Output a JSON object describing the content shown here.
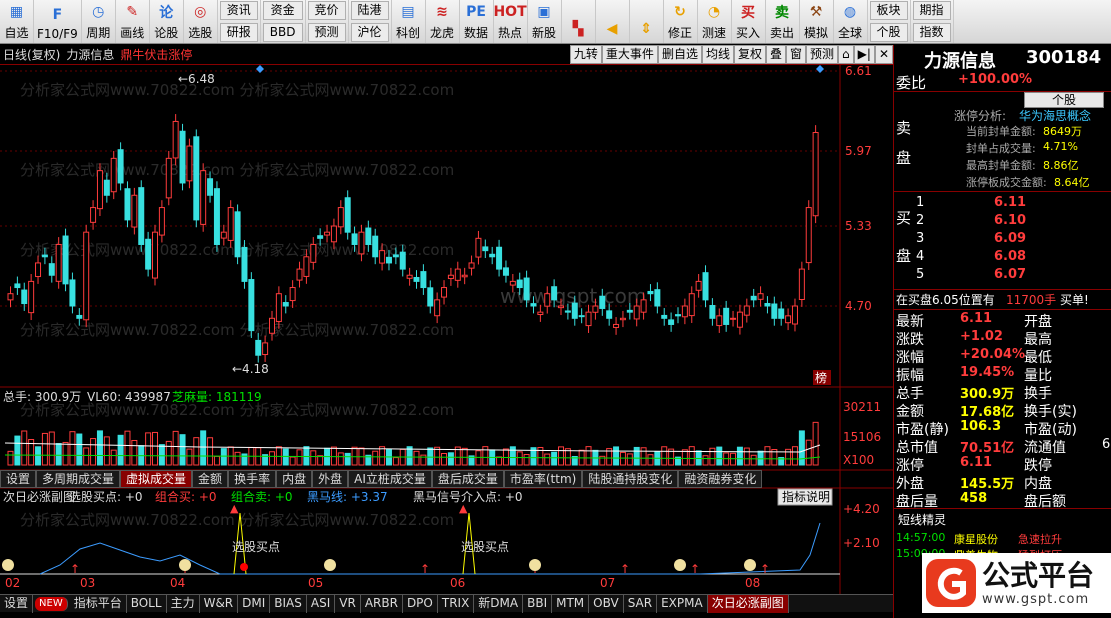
{
  "toolbar": {
    "items": [
      {
        "label": "自选",
        "icon": "grid-icon",
        "color": "#2a6fd6"
      },
      {
        "label": "F10/F9",
        "icon": "f10-icon",
        "color": "#2a6fd6"
      },
      {
        "label": "周期",
        "icon": "clock-icon",
        "color": "#2a6fd6"
      },
      {
        "label": "画线",
        "icon": "pencil-icon",
        "color": "#cc2222"
      },
      {
        "label": "论股",
        "icon": "talk-icon",
        "color": "#2a6fd6"
      },
      {
        "label": "选股",
        "icon": "radar-icon",
        "color": "#cc2222"
      }
    ],
    "pairs": [
      [
        "资讯",
        "研报"
      ],
      [
        "资金",
        "BBD"
      ],
      [
        "竞价",
        "预测"
      ],
      [
        "陆港",
        "沪伦"
      ]
    ],
    "items2": [
      {
        "label": "科创",
        "icon": "chart-icon",
        "color": "#2a6fd6"
      },
      {
        "label": "龙虎",
        "icon": "dragon-icon",
        "color": "#cc2222"
      },
      {
        "label": "数据",
        "icon": "pe-icon",
        "color": "#2a6fd6"
      },
      {
        "label": "热点",
        "icon": "hot-icon",
        "color": "#cc2222"
      },
      {
        "label": "新股",
        "icon": "ipo-icon",
        "color": "#2a6fd6"
      }
    ],
    "items3": [
      {
        "label": "",
        "icon": "multi-window-icon",
        "color": "#cc2222"
      },
      {
        "label": "",
        "icon": "back-arrow-icon",
        "color": "#e8a000"
      },
      {
        "label": "",
        "icon": "updown-arrow-icon",
        "color": "#e8a000"
      },
      {
        "label": "修正",
        "icon": "refresh-icon",
        "color": "#e8a000"
      },
      {
        "label": "测速",
        "icon": "stopwatch-icon",
        "color": "#e8a000"
      },
      {
        "label": "买入",
        "icon": "buy-icon",
        "color": "#cc2222"
      },
      {
        "label": "卖出",
        "icon": "sell-icon",
        "color": "#008800"
      },
      {
        "label": "模拟",
        "icon": "gavel-icon",
        "color": "#8b4513"
      },
      {
        "label": "全球",
        "icon": "globe-icon",
        "color": "#2a6fd6"
      }
    ],
    "pairs2": [
      [
        "板块",
        "个股"
      ],
      [
        "期指",
        "指数"
      ]
    ]
  },
  "title": {
    "label": "日线(复权)",
    "stock": "力源信息",
    "signal": "鼎牛伏击涨停",
    "buttons": [
      "九转",
      "重大事件",
      "删自选",
      "均线",
      "复权",
      "叠",
      "窗",
      "预测",
      "⌂",
      "▶|",
      "✕"
    ]
  },
  "chart_data": {
    "type": "candlestick",
    "price_ticks": [
      "6.61",
      "5.97",
      "5.33",
      "4.70"
    ],
    "high_label": "6.48",
    "low_label": "4.18",
    "volume_header": {
      "total": "总手: 300.9万",
      "vl60": "VL60: 439987",
      "zhima": "芝麻量: 181119"
    },
    "volume_ticks": [
      "30211",
      "15106",
      "X100"
    ],
    "indicator_header": {
      "name": "次日必涨副图",
      "a": "选股买点: +0",
      "b": "组合买: +0",
      "c": "组合卖: +0",
      "d": "黑马线: +3.37",
      "e": "黑马信号介入点: +0"
    },
    "indicator_button": "指标说明",
    "indicator_ticks": [
      "4.20",
      "2.10"
    ],
    "buy_labels": [
      "选股买点",
      "选股买点"
    ],
    "months": [
      "02",
      "03",
      "04",
      "05",
      "06",
      "07",
      "08"
    ],
    "watermark": "分析家公式网www.70822.com",
    "center_mark": "www.gspt.com",
    "rank_badge": "榜"
  },
  "tabs1": [
    "设置",
    "多周期成交量",
    "虚拟成交量",
    "金额",
    "换手率",
    "内盘",
    "外盘",
    "AI立桩成交量",
    "盘后成交量",
    "市盈率(ttm)",
    "陆股通持股变化",
    "融资融券变化"
  ],
  "tabs1_active": 2,
  "bottom_tabs": [
    "设置",
    "NEW",
    "指标平台",
    "BOLL",
    "主力",
    "W&R",
    "DMI",
    "BIAS",
    "ASI",
    "VR",
    "ARBR",
    "DPO",
    "TRIX",
    "新DMA",
    "BBI",
    "MTM",
    "OBV",
    "SAR",
    "EXPMA",
    "次日必涨副图"
  ],
  "bottom_active": 19,
  "right_panel": {
    "name": "力源信息",
    "code": "300184",
    "weibi_label": "委比",
    "weibi_value": "+100.00%",
    "weibi_btn": "个股",
    "sell_label": [
      "卖",
      "盘"
    ],
    "limit_title": "涨停分析:",
    "limit_concept": "华为海思概念",
    "limit_rows": [
      [
        "当前封单金额:",
        "8649万"
      ],
      [
        "封单占成交量:",
        "4.71%"
      ],
      [
        "最高封单金额:",
        "8.86亿"
      ],
      [
        "涨停板成交金额:",
        "8.64亿"
      ]
    ],
    "buy_label": [
      "买",
      "盘"
    ],
    "buys": [
      [
        "1",
        "6.11"
      ],
      [
        "2",
        "6.10"
      ],
      [
        "3",
        "6.09"
      ],
      [
        "4",
        "6.08"
      ],
      [
        "5",
        "6.07"
      ]
    ],
    "info_line": "在买盘6.05位置有",
    "info_vol": "11700手",
    "info_act": "买单!",
    "stats": [
      [
        "最新",
        "6.11",
        "开盘",
        ""
      ],
      [
        "涨跌",
        "+1.02",
        "最高",
        ""
      ],
      [
        "涨幅",
        "+20.04%",
        "最低",
        ""
      ],
      [
        "振幅",
        "19.45%",
        "量比",
        ""
      ],
      [
        "总手",
        "300.9万",
        "换手",
        ""
      ],
      [
        "金额",
        "17.68亿",
        "换手(实)",
        ""
      ],
      [
        "市盈(静)",
        "106.3",
        "市盈(动)",
        ""
      ],
      [
        "总市值",
        "70.51亿",
        "流通值",
        "6"
      ],
      [
        "涨停",
        "6.11",
        "跌停",
        ""
      ],
      [
        "外盘",
        "145.5万",
        "内盘",
        ""
      ],
      [
        "盘后量",
        "458",
        "盘后额",
        ""
      ]
    ],
    "sprite_title": "短线精灵",
    "sprites": [
      [
        "14:57:00",
        "康星股份",
        "急速拉升"
      ],
      [
        "15:00:00",
        "鼎善生物",
        "猛烈打压"
      ]
    ],
    "logo_text": "公式平台",
    "logo_url": "www.gspt.com"
  }
}
